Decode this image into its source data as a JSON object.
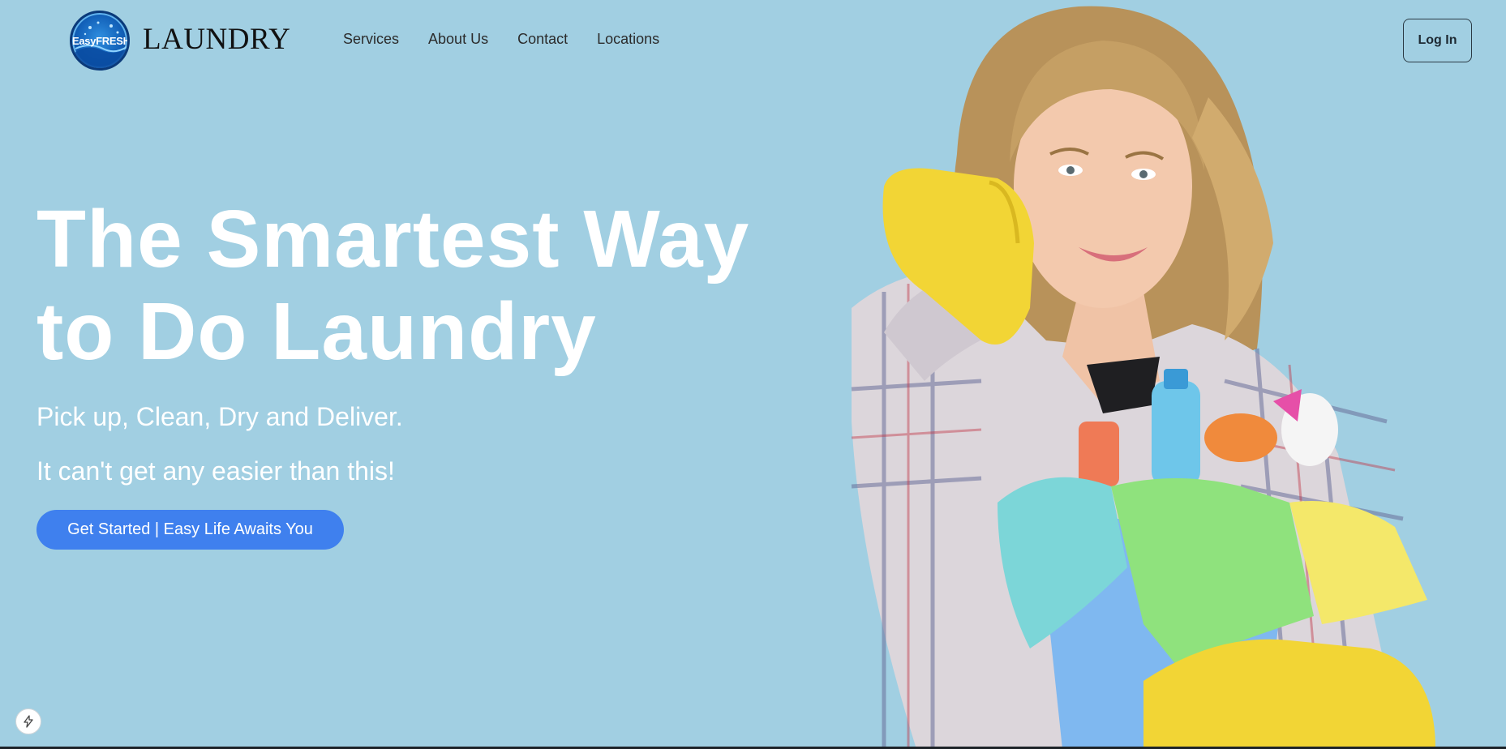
{
  "brand": {
    "badge_text": "EasyFRESH",
    "wordmark": "LAUNDRY"
  },
  "nav": {
    "items": [
      {
        "label": "Services"
      },
      {
        "label": "About Us"
      },
      {
        "label": "Contact"
      },
      {
        "label": "Locations"
      }
    ]
  },
  "header": {
    "login_label": "Log In"
  },
  "hero": {
    "title_line1": "The Smartest Way",
    "title_line2": "to Do Laundry",
    "subtitle1": "Pick up, Clean, Dry and Deliver.",
    "subtitle2": "It can't get any easier than this!",
    "cta_label": "Get Started | Easy Life Awaits You",
    "image_description_icon": "woman-with-cleaning-supplies-photo"
  },
  "floating": {
    "icon": "lightning-bolt-icon"
  },
  "colors": {
    "background": "#a1cfe2",
    "cta": "#3f80ee",
    "title": "#ffffff",
    "brand_blue": "#1260b8"
  }
}
